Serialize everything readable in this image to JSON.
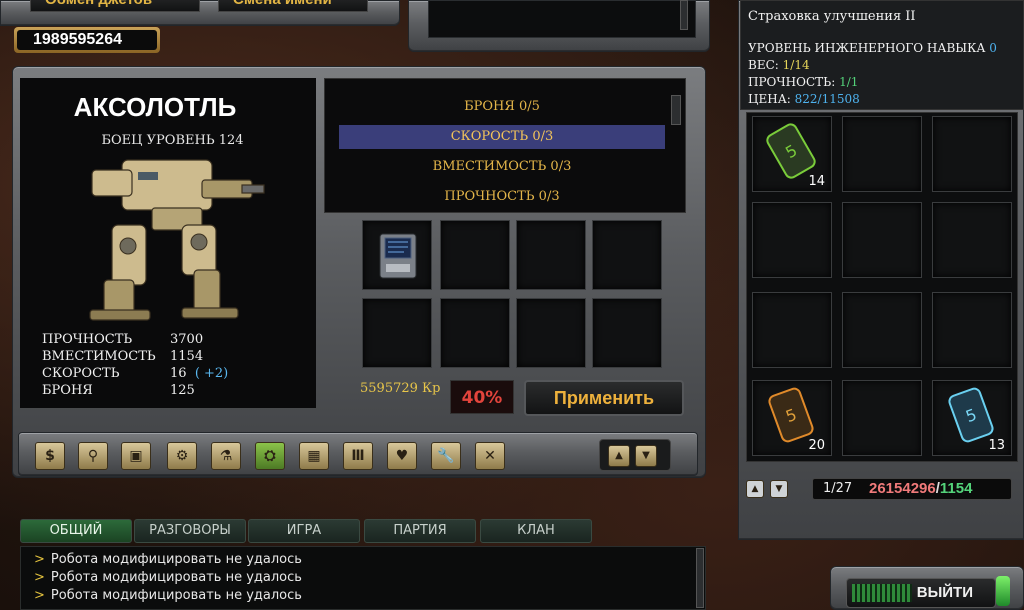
{
  "top_buttons": {
    "jets_swap": "Обмен джетов",
    "rename": "Смена имени"
  },
  "money": "1989595264",
  "robot": {
    "name": "АКСОЛОТЛЬ",
    "level": "БОЕЦ УРОВЕНЬ 124",
    "stats": [
      {
        "label": "ПРОЧНОСТЬ",
        "value": "3700",
        "bonus": ""
      },
      {
        "label": "ВМЕСТИМОСТЬ",
        "value": "1154",
        "bonus": ""
      },
      {
        "label": "СКОРОСТЬ",
        "value": "16",
        "bonus": "( +2)"
      },
      {
        "label": "БРОНЯ",
        "value": "125",
        "bonus": ""
      }
    ]
  },
  "upgrades": {
    "items": [
      "БРОНЯ 0/5",
      "СКОРОСТЬ 0/3",
      "ВМЕСТИМОСТЬ 0/3",
      "ПРОЧНОСТЬ 0/3"
    ],
    "selected_index": 1
  },
  "apply": {
    "credits": "5595729 Кр",
    "chance": "40%",
    "button": "Применить"
  },
  "toolbar_icons": [
    "dollar-icon",
    "robot-icon",
    "crate-icon",
    "gear-box-icon",
    "flask-icon",
    "wrench-gear-icon",
    "blocks-icon",
    "columns-icon",
    "heart-icon",
    "wrench-icon",
    "cross-tools-icon"
  ],
  "toolbar_glyphs": [
    "$",
    "⚲",
    "▣",
    "⚙",
    "⚗",
    "⛭",
    "▦",
    "Ⅲ",
    "♥",
    "🔧",
    "✕"
  ],
  "toolbar_active_index": 5,
  "item_info": {
    "title": "Страховка улучшения II",
    "skill_label": "УРОВЕНЬ ИНЖЕНЕРНОГО НАВЫКА",
    "skill_value": "0",
    "weight_label": "ВЕС:",
    "weight_value": "1/14",
    "durability_label": "ПРОЧНОСТЬ:",
    "durability_value": "1/1",
    "price_label": "ЦЕНА:",
    "price_value": "822/11508"
  },
  "inventory": {
    "counts": {
      "slot_1": "14",
      "slot_13": "20",
      "slot_15": "13"
    },
    "page": "1/27",
    "weight_used": "26154296",
    "weight_sep": "/",
    "weight_cap": "1154"
  },
  "chat": {
    "tabs": [
      "ОБЩИЙ",
      "РАЗГОВОРЫ",
      "ИГРА",
      "ПАРТИЯ",
      "КЛАН"
    ],
    "active_tab": 0,
    "arrow": ">",
    "lines": [
      "Робота модифицировать не удалось",
      "Робота модифицировать не удалось",
      "Робота модифицировать не удалось"
    ]
  },
  "exit_button": "ВЫЙТИ",
  "colors": {
    "gold": "#e4b64a",
    "blue": "#4eb2ee",
    "red_value": "#f07a7a",
    "green_value": "#54d37a"
  }
}
